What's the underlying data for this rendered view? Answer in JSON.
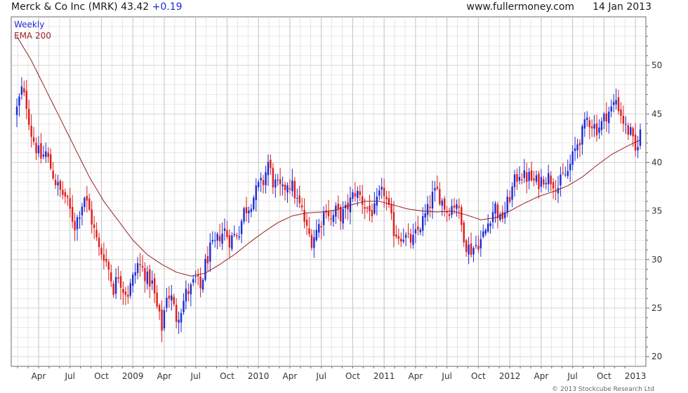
{
  "header": {
    "company": "Merck & Co Inc (MRK)",
    "price": "43.42",
    "change": "+0.19",
    "website": "www.fullermoney.com",
    "date": "14 Jan 2013"
  },
  "legend": {
    "series1": "Weekly",
    "series2": "EMA 200"
  },
  "copyright": "© 2013 Stockcube Research Ltd",
  "colors": {
    "up": "#1c2bd8",
    "down": "#e21b1b",
    "ema": "#9a1f1f",
    "grid": "#d4d4d4"
  },
  "chart_data": {
    "type": "candlestick",
    "title": "Merck & Co Inc (MRK) 43.42 +0.19",
    "frequency": "Weekly",
    "ylim": [
      19,
      55
    ],
    "yticks": [
      20,
      25,
      30,
      35,
      40,
      45,
      50
    ],
    "xticks": [
      {
        "label": "Apr",
        "week": 9
      },
      {
        "label": "Jul",
        "week": 22
      },
      {
        "label": "Oct",
        "week": 35
      },
      {
        "label": "2009",
        "week": 48
      },
      {
        "label": "Apr",
        "week": 61
      },
      {
        "label": "Jul",
        "week": 74
      },
      {
        "label": "Oct",
        "week": 87
      },
      {
        "label": "2010",
        "week": 100
      },
      {
        "label": "Apr",
        "week": 113
      },
      {
        "label": "Jul",
        "week": 126
      },
      {
        "label": "Oct",
        "week": 139
      },
      {
        "label": "2011",
        "week": 152
      },
      {
        "label": "Apr",
        "week": 165
      },
      {
        "label": "Jul",
        "week": 178
      },
      {
        "label": "Oct",
        "week": 191
      },
      {
        "label": "2012",
        "week": 204
      },
      {
        "label": "Apr",
        "week": 217
      },
      {
        "label": "Jul",
        "week": 230
      },
      {
        "label": "Oct",
        "week": 243
      },
      {
        "label": "2013",
        "week": 256
      }
    ],
    "weeks_total": 259,
    "price_anchors": [
      [
        0,
        45.5
      ],
      [
        2,
        47.5
      ],
      [
        4,
        46
      ],
      [
        6,
        43
      ],
      [
        8,
        41.5
      ],
      [
        10,
        40.5
      ],
      [
        12,
        41
      ],
      [
        14,
        39.5
      ],
      [
        16,
        38
      ],
      [
        18,
        37
      ],
      [
        20,
        36.5
      ],
      [
        22,
        35
      ],
      [
        24,
        33.5
      ],
      [
        26,
        35
      ],
      [
        28,
        36.5
      ],
      [
        30,
        35
      ],
      [
        32,
        33
      ],
      [
        34,
        31
      ],
      [
        36,
        30.5
      ],
      [
        38,
        29
      ],
      [
        40,
        27
      ],
      [
        42,
        28.5
      ],
      [
        44,
        27
      ],
      [
        46,
        26.5
      ],
      [
        48,
        28
      ],
      [
        50,
        29.5
      ],
      [
        52,
        29
      ],
      [
        54,
        28
      ],
      [
        56,
        27.5
      ],
      [
        58,
        25
      ],
      [
        60,
        23
      ],
      [
        62,
        26.5
      ],
      [
        64,
        26
      ],
      [
        66,
        24
      ],
      [
        68,
        25
      ],
      [
        70,
        26.5
      ],
      [
        72,
        27
      ],
      [
        74,
        28
      ],
      [
        76,
        27
      ],
      [
        78,
        29.5
      ],
      [
        80,
        31
      ],
      [
        82,
        31.5
      ],
      [
        84,
        32.5
      ],
      [
        86,
        33
      ],
      [
        88,
        32
      ],
      [
        90,
        32.5
      ],
      [
        92,
        33
      ],
      [
        94,
        35
      ],
      [
        96,
        35.5
      ],
      [
        98,
        36.5
      ],
      [
        100,
        37.5
      ],
      [
        102,
        38
      ],
      [
        104,
        40
      ],
      [
        106,
        38
      ],
      [
        108,
        37.5
      ],
      [
        110,
        37
      ],
      [
        112,
        38
      ],
      [
        114,
        37.5
      ],
      [
        116,
        36
      ],
      [
        118,
        35
      ],
      [
        120,
        33
      ],
      [
        122,
        32
      ],
      [
        124,
        33
      ],
      [
        126,
        34
      ],
      [
        128,
        35.5
      ],
      [
        130,
        34
      ],
      [
        132,
        35
      ],
      [
        134,
        34.5
      ],
      [
        136,
        35
      ],
      [
        138,
        36
      ],
      [
        140,
        37
      ],
      [
        142,
        36.5
      ],
      [
        144,
        35.5
      ],
      [
        146,
        35
      ],
      [
        148,
        35
      ],
      [
        150,
        36.5
      ],
      [
        152,
        37
      ],
      [
        154,
        35
      ],
      [
        156,
        33
      ],
      [
        158,
        32.5
      ],
      [
        160,
        32.5
      ],
      [
        162,
        32
      ],
      [
        164,
        32
      ],
      [
        166,
        33
      ],
      [
        168,
        34
      ],
      [
        170,
        35
      ],
      [
        172,
        36.5
      ],
      [
        174,
        37
      ],
      [
        176,
        36
      ],
      [
        178,
        35
      ],
      [
        180,
        35.5
      ],
      [
        182,
        36
      ],
      [
        184,
        33.5
      ],
      [
        186,
        31.5
      ],
      [
        188,
        31
      ],
      [
        190,
        31.5
      ],
      [
        192,
        32
      ],
      [
        194,
        33
      ],
      [
        196,
        34.5
      ],
      [
        198,
        35.5
      ],
      [
        200,
        34
      ],
      [
        202,
        35
      ],
      [
        204,
        36.5
      ],
      [
        206,
        38
      ],
      [
        208,
        39
      ],
      [
        210,
        38.5
      ],
      [
        212,
        38.5
      ],
      [
        214,
        38
      ],
      [
        216,
        38
      ],
      [
        218,
        38.5
      ],
      [
        220,
        38.5
      ],
      [
        222,
        38
      ],
      [
        224,
        37.5
      ],
      [
        226,
        38.5
      ],
      [
        228,
        39
      ],
      [
        230,
        40.5
      ],
      [
        232,
        42
      ],
      [
        234,
        43
      ],
      [
        236,
        44.5
      ],
      [
        238,
        44
      ],
      [
        240,
        43.5
      ],
      [
        242,
        44
      ],
      [
        244,
        45
      ],
      [
        246,
        45.5
      ],
      [
        248,
        46.5
      ],
      [
        250,
        45
      ],
      [
        252,
        43.5
      ],
      [
        254,
        43
      ],
      [
        256,
        41
      ],
      [
        258,
        43.4
      ]
    ],
    "ema_anchors": [
      [
        0,
        53
      ],
      [
        6,
        50.5
      ],
      [
        12,
        47.5
      ],
      [
        18,
        44.5
      ],
      [
        24,
        41.5
      ],
      [
        30,
        38.5
      ],
      [
        36,
        36
      ],
      [
        42,
        34
      ],
      [
        48,
        32
      ],
      [
        54,
        30.5
      ],
      [
        60,
        29.5
      ],
      [
        66,
        28.7
      ],
      [
        72,
        28.3
      ],
      [
        78,
        28.6
      ],
      [
        84,
        29.5
      ],
      [
        90,
        30.5
      ],
      [
        96,
        31.7
      ],
      [
        102,
        32.8
      ],
      [
        108,
        33.8
      ],
      [
        114,
        34.5
      ],
      [
        120,
        34.8
      ],
      [
        126,
        34.9
      ],
      [
        132,
        35.1
      ],
      [
        138,
        35.6
      ],
      [
        144,
        36
      ],
      [
        150,
        36
      ],
      [
        156,
        35.6
      ],
      [
        162,
        35.2
      ],
      [
        168,
        35
      ],
      [
        174,
        34.9
      ],
      [
        180,
        35
      ],
      [
        186,
        34.6
      ],
      [
        192,
        34.1
      ],
      [
        198,
        34.3
      ],
      [
        204,
        35
      ],
      [
        210,
        35.8
      ],
      [
        216,
        36.5
      ],
      [
        222,
        37
      ],
      [
        228,
        37.6
      ],
      [
        234,
        38.5
      ],
      [
        240,
        39.7
      ],
      [
        246,
        40.8
      ],
      [
        252,
        41.6
      ],
      [
        256,
        42.1
      ],
      [
        258,
        42.3
      ]
    ]
  }
}
